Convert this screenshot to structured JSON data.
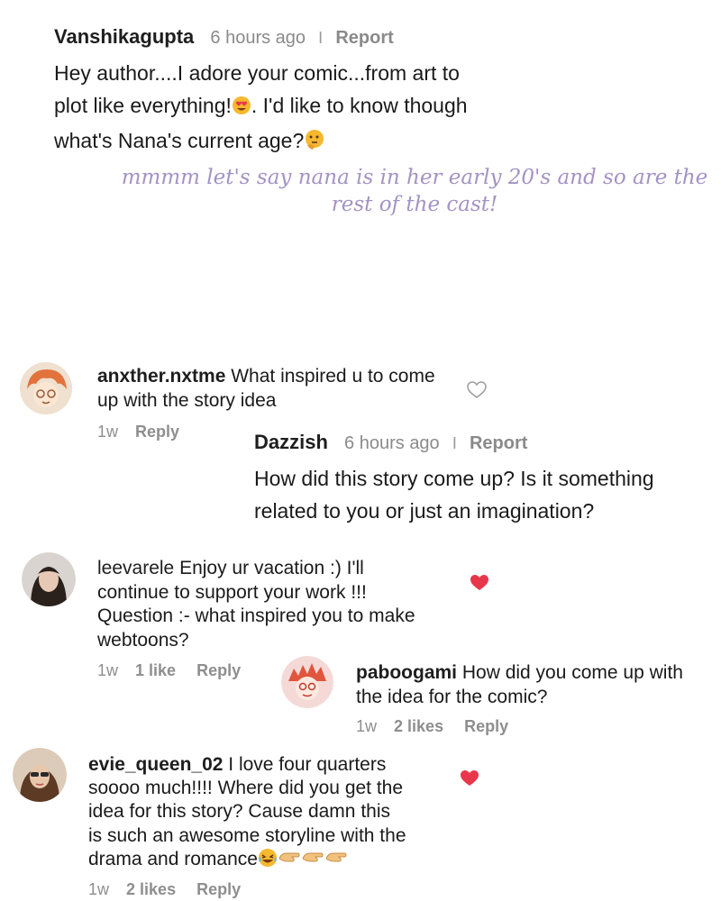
{
  "post_top": {
    "username": "Vanshikagupta",
    "time": "6 hours ago",
    "separator": "I",
    "report": "Report",
    "line1": "Hey author....I adore your comic...from art to",
    "line2a": "plot like everything!",
    "line2b": ". I'd like to know though",
    "line3": "what's Nana's current age?",
    "emoji_1": "heart-eyes-emoji",
    "emoji_2": "thinking-emoji"
  },
  "answer_note": {
    "line1": "mmmm let's say nana is in her early 20's and so are the",
    "line2": "rest of the cast!"
  },
  "comments": {
    "c1": {
      "username": "anxther.nxtme",
      "text1": " What inspired u to come",
      "text2": "up with the story idea",
      "age": "1w",
      "reply": "Reply",
      "like_icon": "heart-outline-icon"
    },
    "dazzish": {
      "username": "Dazzish",
      "time": "6 hours ago",
      "separator": "I",
      "report": "Report",
      "line1": "How did this story come up? Is it something",
      "line2": "related to you or just an imagination?"
    },
    "c2": {
      "username": "leevarele",
      "text1": " Enjoy ur vacation :) I'll",
      "text2": "continue to support your work !!!",
      "text3": "Question :- what inspired you to make",
      "text4": "webtoons?",
      "age": "1w",
      "likes": "1 like",
      "reply": "Reply",
      "like_icon": "heart-filled-icon"
    },
    "c3": {
      "username": "paboogami",
      "text1": " How did you come up with",
      "text2": "the idea for the comic?",
      "age": "1w",
      "likes": "2 likes",
      "reply": "Reply"
    },
    "c4": {
      "username": "evie_queen_02",
      "text1": " I love four quarters",
      "text2": "soooo much!!!! Where did you get the",
      "text3": "idea for this story? Cause damn this",
      "text4": "is such an awesome storyline with the",
      "text5": "drama and romance",
      "age": "1w",
      "likes": "2 likes",
      "reply": "Reply",
      "like_icon": "heart-filled-icon"
    }
  },
  "colors": {
    "heart_red": "#e8374a",
    "note_purple": "#a393c4"
  }
}
